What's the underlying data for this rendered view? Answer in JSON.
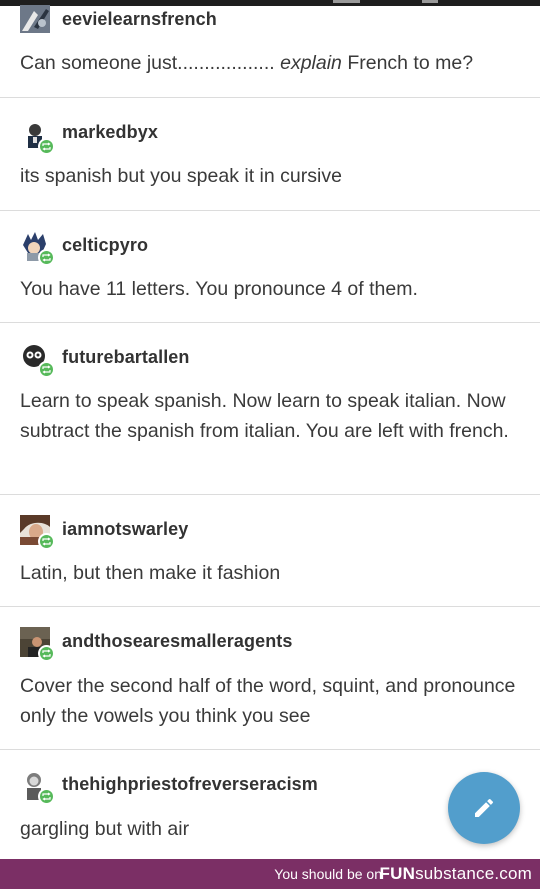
{
  "posts": [
    {
      "username": "eevielearnsfrench",
      "text_before": "Can someone just.................. ",
      "text_italic": "explain",
      "text_after": " French to me?",
      "reblogged": false
    },
    {
      "username": "markedbyx",
      "text": "its spanish but you speak it in cursive",
      "reblogged": true
    },
    {
      "username": "celticpyro",
      "text": "You have 11 letters. You pronounce 4 of them.",
      "reblogged": true
    },
    {
      "username": "futurebartallen",
      "text": "Learn to speak spanish. Now learn to speak italian. Now subtract the spanish from italian. You are left with french.",
      "reblogged": true
    },
    {
      "username": "iamnotswarley",
      "text": "Latin, but then make it fashion",
      "reblogged": true
    },
    {
      "username": "andthosearesmalleragents",
      "text": "Cover the second half of the word, squint, and pronounce only the vowels you think you see",
      "reblogged": true
    },
    {
      "username": "thehighpriestofreverseracism",
      "text": "gargling but with air",
      "reblogged": true
    }
  ],
  "fab": {
    "icon": "pencil-icon",
    "color": "#529ecc"
  },
  "footer": {
    "message": "You should be on",
    "brand_bold": "FUN",
    "brand_light": "substance",
    "brand_suffix": ".com",
    "color": "#7b2f65"
  },
  "colors": {
    "reblog": "#56b95a",
    "divider": "#dcdcdc"
  }
}
